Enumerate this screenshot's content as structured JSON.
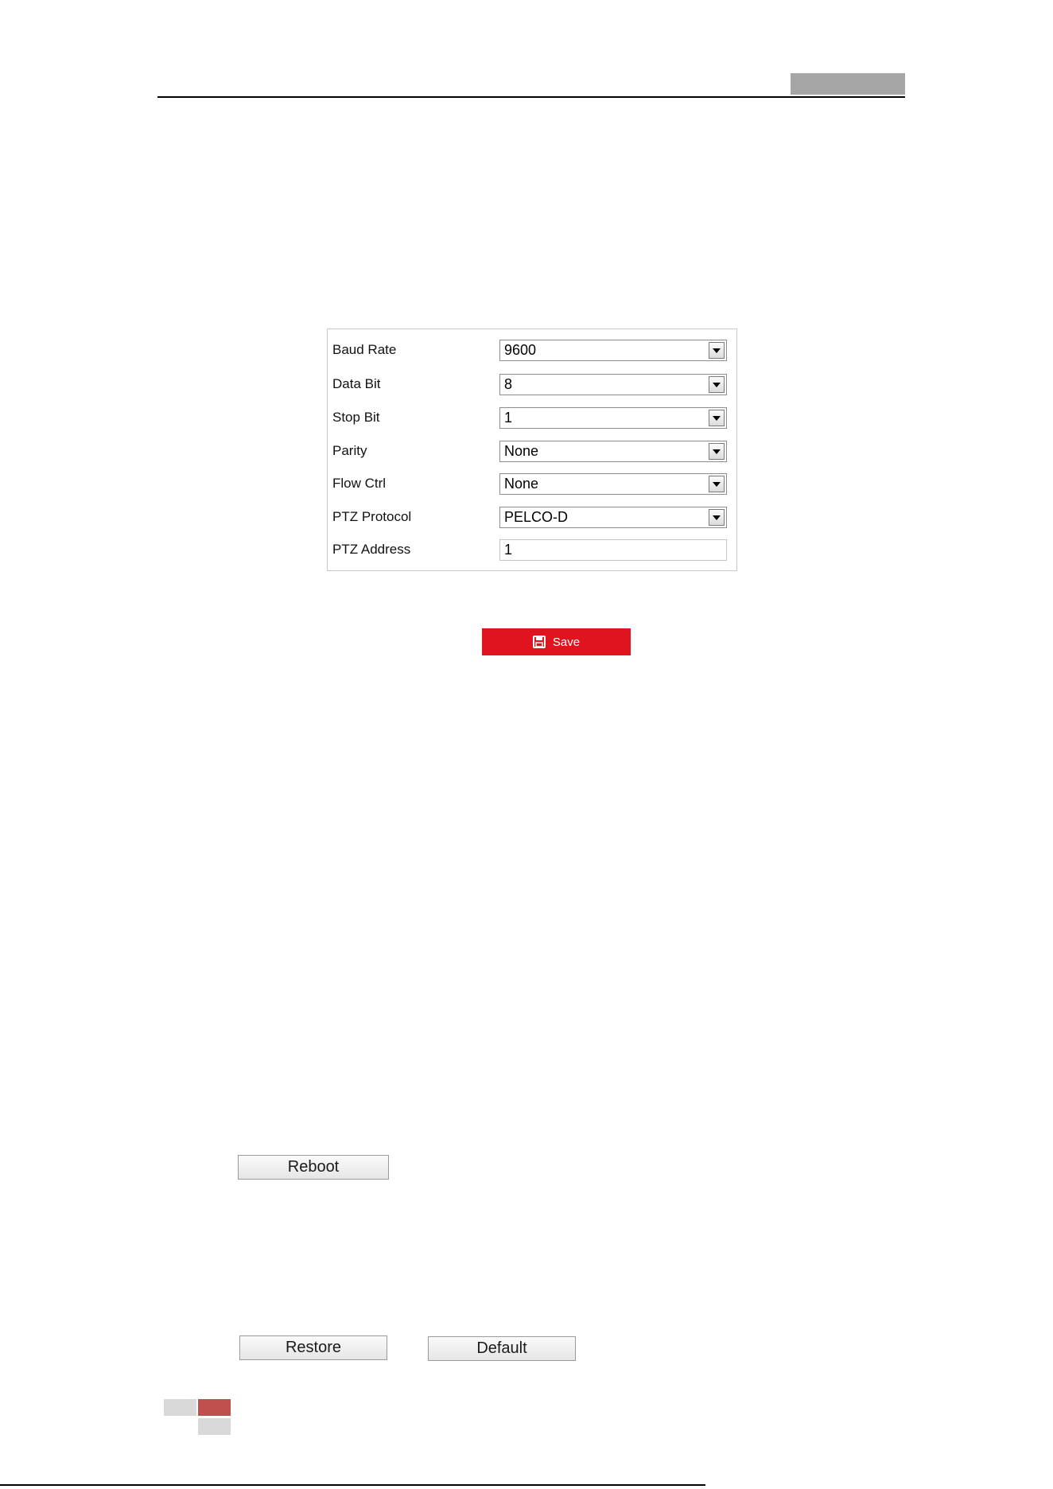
{
  "serial_settings": {
    "rows": [
      {
        "label": "Baud Rate",
        "value": "9600",
        "control": "select"
      },
      {
        "label": "Data Bit",
        "value": "8",
        "control": "select"
      },
      {
        "label": "Stop Bit",
        "value": "1",
        "control": "select"
      },
      {
        "label": "Parity",
        "value": "None",
        "control": "select"
      },
      {
        "label": "Flow Ctrl",
        "value": "None",
        "control": "select"
      },
      {
        "label": "PTZ Protocol",
        "value": "PELCO-D",
        "control": "select"
      },
      {
        "label": "PTZ Address",
        "value": "1",
        "control": "text"
      }
    ]
  },
  "save_button": {
    "label": "Save",
    "icon": "save-icon",
    "color": "#e0141e"
  },
  "maintenance": {
    "reboot_label": "Reboot",
    "restore_label": "Restore",
    "default_label": "Default"
  },
  "colors": {
    "header_tab": "#a6a6a6",
    "footer_accent": "#c0504d",
    "footer_gray": "#d9d9d9"
  }
}
